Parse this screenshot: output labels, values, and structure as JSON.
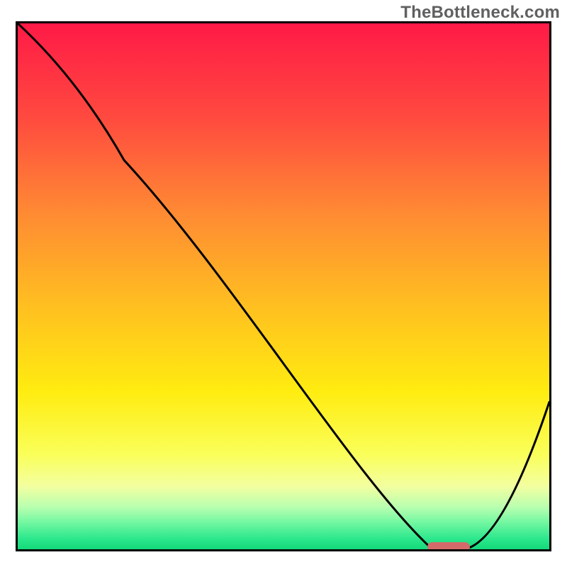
{
  "attribution": "TheBottleneck.com",
  "chart_data": {
    "type": "line",
    "title": "",
    "xlabel": "",
    "ylabel": "",
    "xlim": [
      0,
      100
    ],
    "ylim": [
      0,
      100
    ],
    "grid": false,
    "legend": false,
    "series": [
      {
        "name": "bottleneck-curve",
        "x": [
          0,
          20,
          78,
          84,
          100
        ],
        "y": [
          100,
          74,
          0,
          0,
          28
        ]
      }
    ],
    "optimum_marker": {
      "x_start": 77,
      "x_end": 85,
      "y": 0.4
    },
    "background_gradient_stops": [
      {
        "pos": 0.0,
        "color": "#ff1a47"
      },
      {
        "pos": 0.18,
        "color": "#ff4a3f"
      },
      {
        "pos": 0.36,
        "color": "#ff8a33"
      },
      {
        "pos": 0.54,
        "color": "#ffc020"
      },
      {
        "pos": 0.7,
        "color": "#ffec10"
      },
      {
        "pos": 0.82,
        "color": "#faff5a"
      },
      {
        "pos": 0.88,
        "color": "#f3ffa0"
      },
      {
        "pos": 0.92,
        "color": "#b8ffb0"
      },
      {
        "pos": 0.95,
        "color": "#70f7a0"
      },
      {
        "pos": 0.98,
        "color": "#2ce78d"
      },
      {
        "pos": 1.0,
        "color": "#14d97a"
      }
    ]
  }
}
